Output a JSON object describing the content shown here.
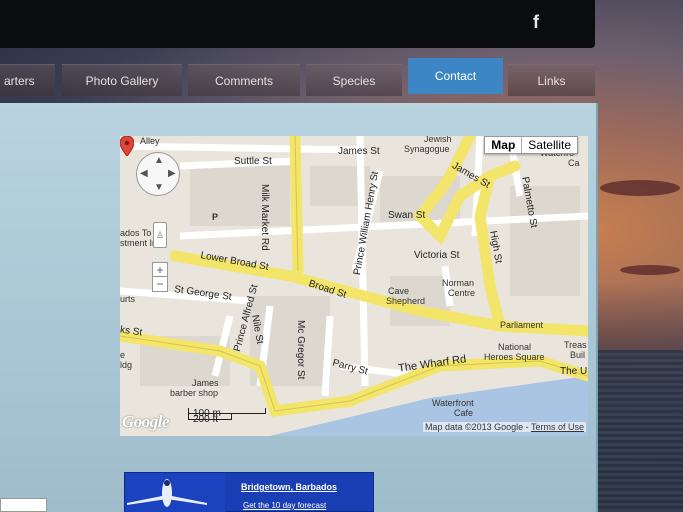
{
  "social": {
    "facebook_glyph": "f"
  },
  "nav": {
    "items": [
      {
        "label": "arters"
      },
      {
        "label": "Photo Gallery"
      },
      {
        "label": "Comments"
      },
      {
        "label": "Species"
      },
      {
        "label": "Contact"
      },
      {
        "label": "Links"
      }
    ],
    "active": "Contact"
  },
  "map": {
    "type_control": {
      "map_label": "Map",
      "satellite_label": "Satellite"
    },
    "labels": {
      "alley": "Alley",
      "jewish": "Jewish",
      "synagogue": "Synagogue",
      "waterfront_ca": "Waterfro",
      "ca": "Ca",
      "suttle": "Suttle St",
      "milk_market": "Milk Market Rd",
      "james1": "James St",
      "james2": "James St",
      "swan": "Swan St",
      "palmetto": "Palmetto St",
      "p": "P",
      "bados": "ados To",
      "stment": "stment In",
      "prince_william": "Prince William Henry St",
      "victoria": "Victoria St",
      "high": "High St",
      "lower_broad": "Lower Broad St",
      "broad": "Broad St",
      "norman": "Norman",
      "centre": "Centre",
      "st_george": "St George St",
      "cave": "Cave",
      "shepherd": "Shepherd",
      "urts": "urts",
      "prince_alfred": "Prince Alfred St",
      "nile": "Nile St",
      "mc_gregor": "Mc Gregor St",
      "parliament": "Parliament",
      "treas": "Treas",
      "buil": "Buil",
      "ks": "ks St",
      "national": "National",
      "heroes": "Heroes Square",
      "e": "e",
      "ldg": "ldg",
      "parry": "Parry St",
      "wharf": "The Wharf Rd",
      "the_u": "The U",
      "james_barber1": "James",
      "james_barber2": "barber shop",
      "waterfront1": "Waterfront",
      "waterfront2": "Cafe"
    },
    "scale": {
      "metric": "100 m",
      "imperial": "200 ft"
    },
    "google_logo": "Google",
    "attribution": "Map data ©2013 Google - ",
    "terms": "Terms of Use",
    "zoom_in": "+",
    "zoom_out": "−"
  },
  "forecast": {
    "title": "Bridgetown, Barbados",
    "link": "Get the 10 day forecast"
  },
  "colors": {
    "active_tab": "#3d86c6",
    "panel": "#b9d3df",
    "road_major": "#f5e86a",
    "forecast_bg": "#1a3fb5"
  }
}
